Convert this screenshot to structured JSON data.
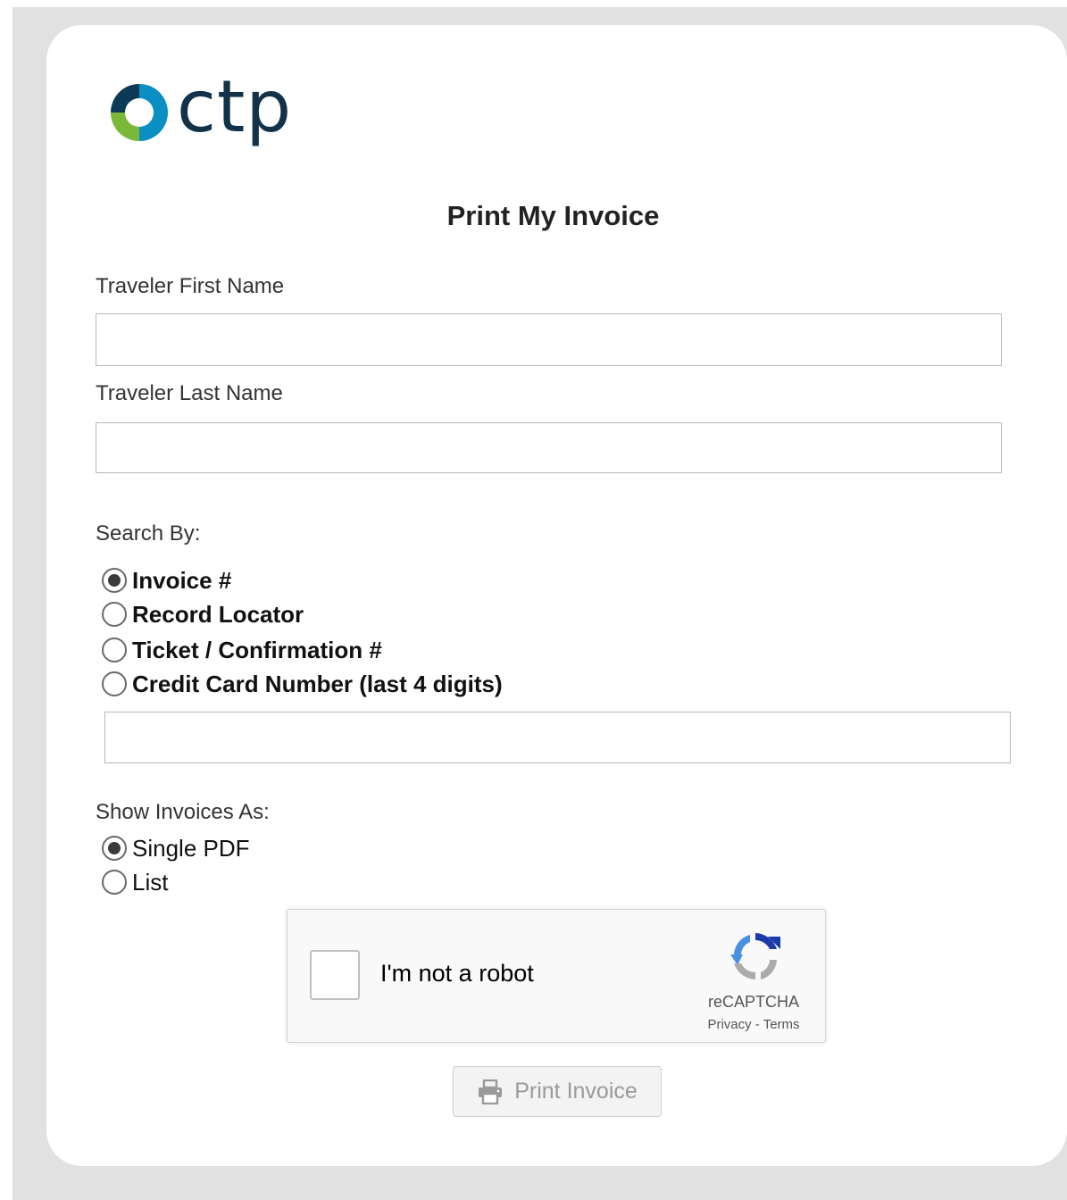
{
  "logo": {
    "text": "ctp"
  },
  "form": {
    "title": "Print My Invoice",
    "first_name": {
      "label": "Traveler First Name",
      "value": "",
      "placeholder": ""
    },
    "last_name": {
      "label": "Traveler Last Name",
      "value": "",
      "placeholder": ""
    },
    "search_by": {
      "label": "Search By:",
      "options": [
        {
          "label": "Invoice #",
          "checked": true
        },
        {
          "label": "Record Locator",
          "checked": false
        },
        {
          "label": "Ticket / Confirmation #",
          "checked": false
        },
        {
          "label": "Credit Card Number (last 4 digits)",
          "checked": false
        }
      ],
      "value": "",
      "placeholder": ""
    },
    "show_as": {
      "label": "Show Invoices As:",
      "options": [
        {
          "label": "Single PDF",
          "checked": true
        },
        {
          "label": "List",
          "checked": false
        }
      ]
    },
    "captcha": {
      "checkbox_label": "I'm not a robot",
      "brand": "reCAPTCHA",
      "privacy_link": "Privacy",
      "separator": " - ",
      "terms_link": "Terms"
    },
    "print_button": {
      "label": "Print Invoice",
      "icon": "printer-icon",
      "disabled": true
    }
  },
  "colors": {
    "page_background": "#e1e1e1",
    "card_background": "#ffffff",
    "logo_text": "#12324a",
    "logo_ring_dark": "#0c3a55",
    "logo_ring_blue": "#0a8fc4",
    "logo_ring_green": "#7ab83a"
  }
}
